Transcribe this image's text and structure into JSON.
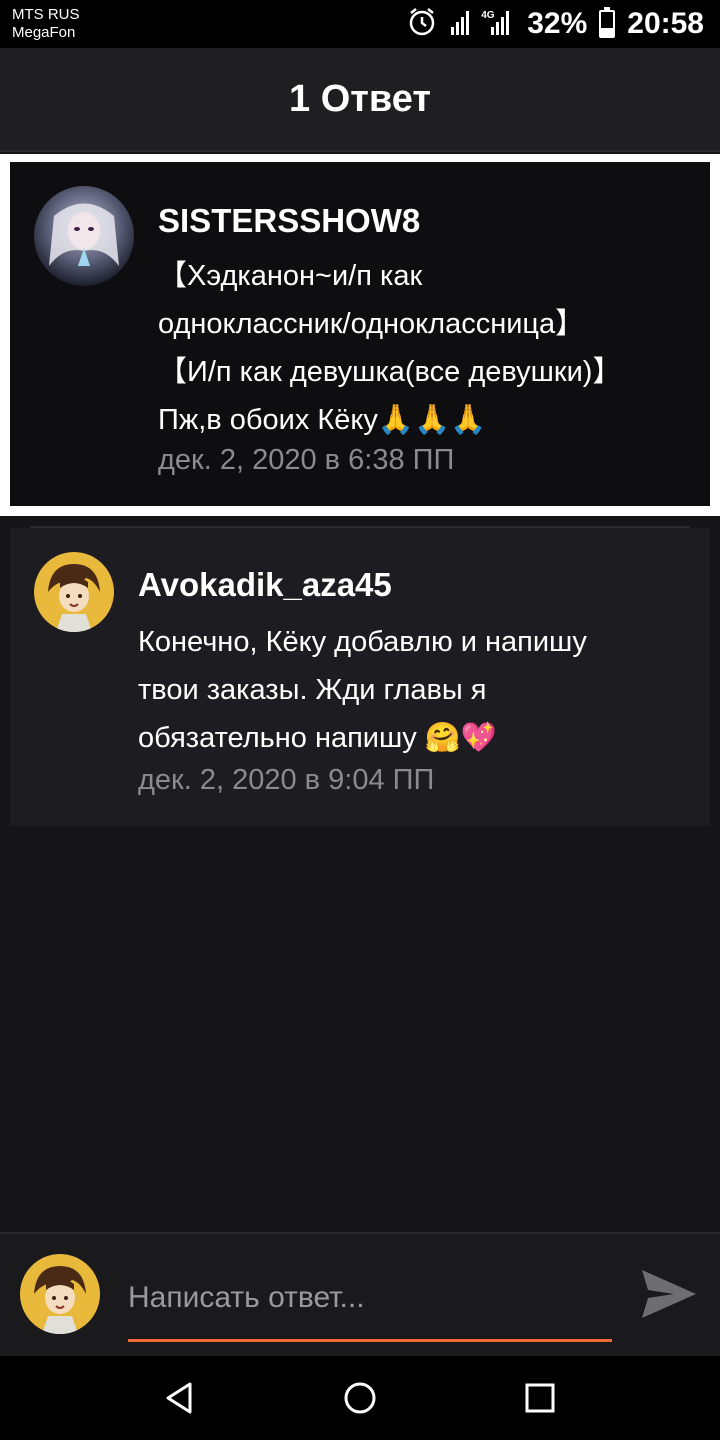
{
  "status_bar": {
    "carrier_line1": "MTS RUS",
    "carrier_line2": "MegaFon",
    "network": "4G",
    "battery": "32%",
    "battery_level": 0.32,
    "time": "20:58",
    "icons": [
      "alarm-icon",
      "signal-icon",
      "battery-icon"
    ]
  },
  "header": {
    "title": "1 Ответ"
  },
  "comment": {
    "author": "SISTERSSHOW8",
    "lines": [
      "【Хэдканон~и/п как",
      "одноклассник/одноклассница】",
      "【И/п как девушка(все девушки)】",
      "Пж,в обоих Кёку🙏🙏🙏"
    ],
    "timestamp": "дек. 2, 2020 в 6:38 ПП"
  },
  "reply": {
    "author": "Avokadik_aza45",
    "lines": [
      "Конечно, Кёку добавлю и напишу",
      "твои заказы. Жди главы я",
      "обязательно напишу 🤗💖"
    ],
    "timestamp": "дек. 2, 2020 в 9:04 ПП"
  },
  "composer": {
    "placeholder": "Написать ответ...",
    "value": "",
    "send_icon": "send-icon"
  },
  "nav_bar": {
    "buttons": [
      "back-icon",
      "home-icon",
      "recents-icon"
    ]
  },
  "colors": {
    "background": "#151417",
    "accent": "#f06a3a",
    "timestamp": "#8b8b8e"
  }
}
